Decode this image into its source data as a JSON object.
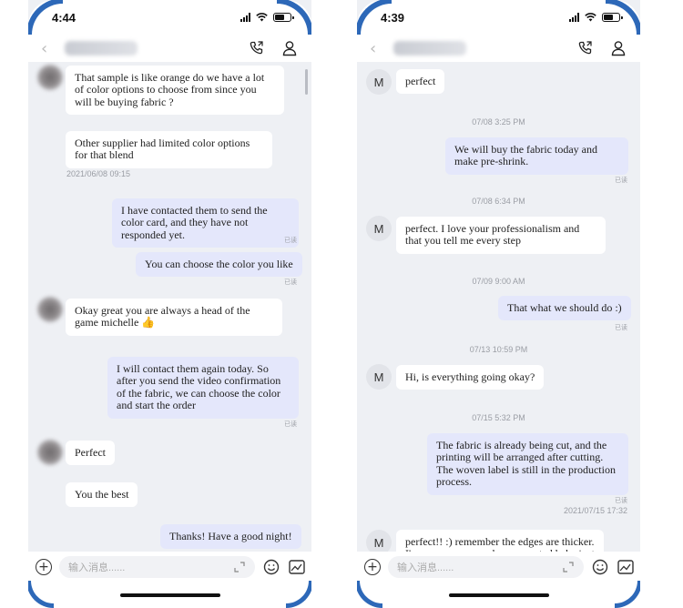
{
  "left_phone": {
    "status_time": "4:44",
    "messages": [
      {
        "side": "in",
        "avatar": "blur",
        "text": "That sample is like orange do we have a lot of color options to choose from since you will be buying fabric ?"
      },
      {
        "side": "in",
        "avatar": "",
        "text": "Other supplier had limited color options for that blend"
      },
      {
        "stamp": "2021/06/08 09:15"
      },
      {
        "side": "out",
        "text": "I have contacted them to send the color card, and they have not responded yet.",
        "read": "已读"
      },
      {
        "side": "out",
        "text": "You can choose the color you like",
        "read": "已读"
      },
      {
        "side": "in",
        "avatar": "blur",
        "text": "Okay great you are always a head of the game michelle",
        "emoji": "👍"
      },
      {
        "side": "out",
        "text": "I will contact them again today. So after you send the video confirmation of the fabric, we can choose the color and start the order",
        "read": "已读"
      },
      {
        "side": "in",
        "avatar": "blur",
        "text": "Perfect"
      },
      {
        "side": "in",
        "avatar": "",
        "text": "You the best"
      },
      {
        "side": "out",
        "text": "Thanks! Have a good night!"
      }
    ],
    "input_placeholder": "输入消息......"
  },
  "right_phone": {
    "status_time": "4:39",
    "messages": [
      {
        "side": "in",
        "avatar": "M",
        "text": "perfect"
      },
      {
        "stamp": "07/08 3:25 PM"
      },
      {
        "side": "out",
        "text": "We will buy the fabric today and make pre-shrink.",
        "read": "已读"
      },
      {
        "stamp": "07/08 6:34 PM"
      },
      {
        "side": "in",
        "avatar": "M",
        "text": "perfect. I love your professionalism and that you tell me every step"
      },
      {
        "stamp": "07/09 9:00 AM"
      },
      {
        "side": "out",
        "text": "That what we should do :)",
        "read": "已读"
      },
      {
        "stamp": "07/13 10:59 PM"
      },
      {
        "side": "in",
        "avatar": "M",
        "text": "Hi, is everything going okay?"
      },
      {
        "stamp": "07/15 5:32 PM"
      },
      {
        "side": "out",
        "text": "The fabric is already being cut, and the printing will be arranged after cutting. The woven label is still in the production process.",
        "read": "已读"
      },
      {
        "stamp": "2021/07/15 17:32"
      },
      {
        "side": "in",
        "avatar": "M",
        "text": "perfect!! :) remember the edges are thicker. I'm sure you remember you noted haha just"
      }
    ],
    "input_placeholder": "输入消息......"
  },
  "colors": {
    "frame_blue": "#2d68b8",
    "chat_background": "#eef0f4",
    "incoming_bubble": "#ffffff",
    "outgoing_bubble": "#e4e7fb"
  }
}
